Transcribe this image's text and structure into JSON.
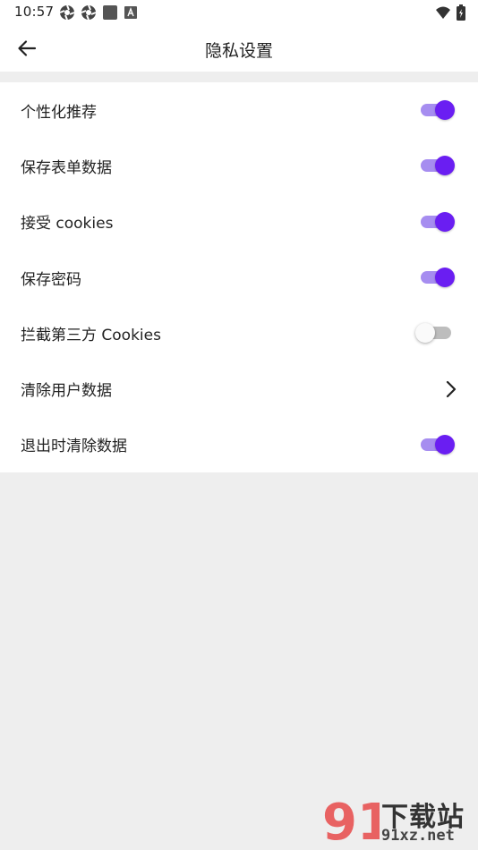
{
  "status_bar": {
    "time": "10:57"
  },
  "header": {
    "title": "隐私设置",
    "back_icon": "arrow-left-icon"
  },
  "settings": [
    {
      "label": "个性化推荐",
      "control": "switch",
      "on": true
    },
    {
      "label": "保存表单数据",
      "control": "switch",
      "on": true
    },
    {
      "label": "接受 cookies",
      "control": "switch",
      "on": true
    },
    {
      "label": "保存密码",
      "control": "switch",
      "on": true
    },
    {
      "label": "拦截第三方 Cookies",
      "control": "switch",
      "on": false
    },
    {
      "label": "清除用户数据",
      "control": "chevron"
    },
    {
      "label": "退出时清除数据",
      "control": "switch",
      "on": true
    }
  ],
  "watermark": {
    "logo_text": "91",
    "title": "下载站",
    "url": "91xz.net"
  },
  "colors": {
    "accent": "#6a1ef2",
    "accent_track": "#a68df0",
    "background": "#eeeeee"
  }
}
